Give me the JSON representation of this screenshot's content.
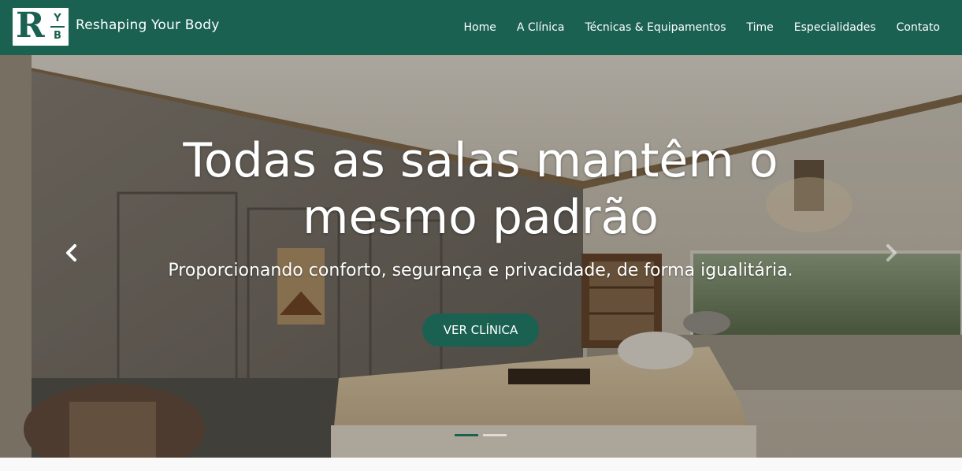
{
  "brand": {
    "logo_letter": "R",
    "logo_y": "Y",
    "logo_b": "B",
    "name": "Reshaping Your Body"
  },
  "nav": {
    "items": [
      {
        "label": "Home"
      },
      {
        "label": "A Clínica"
      },
      {
        "label": "Técnicas & Equipamentos"
      },
      {
        "label": "Time"
      },
      {
        "label": "Especialidades"
      },
      {
        "label": "Contato"
      }
    ]
  },
  "hero": {
    "title": "Todas as salas mantêm o mesmo padrão",
    "subtitle": "Proporcionando conforto, segurança e privacidade, de forma igualitária.",
    "cta_label": "VER CLÍNICA",
    "prev_icon": "chevron-left-icon",
    "next_icon": "chevron-right-icon",
    "slides_count": 2,
    "active_slide": 1
  },
  "colors": {
    "brand_green": "#1a6152",
    "text_light": "#ffffff"
  }
}
